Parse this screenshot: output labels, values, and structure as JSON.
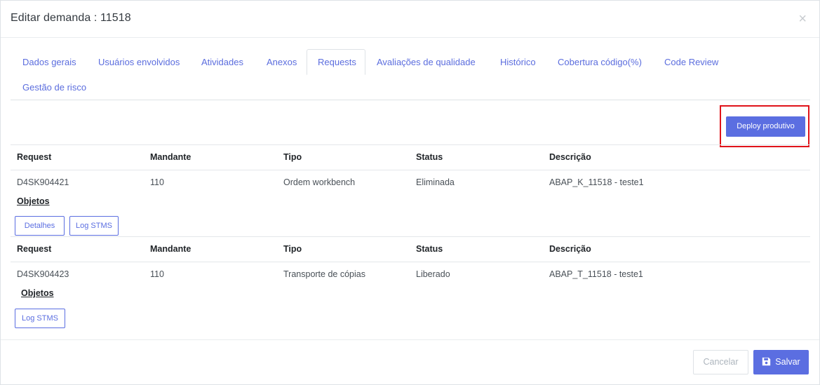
{
  "modal": {
    "title": "Editar demanda : 11518",
    "close_glyph": "×"
  },
  "tabs": [
    {
      "label": "Dados gerais"
    },
    {
      "label": "Usuários envolvidos"
    },
    {
      "label": "Atividades"
    },
    {
      "label": "Anexos"
    },
    {
      "label": "Requests",
      "active": true
    },
    {
      "label": "Avaliações de qualidade"
    },
    {
      "label": "Histórico"
    },
    {
      "label": "Cobertura código(%)"
    },
    {
      "label": "Code Review"
    },
    {
      "label": "Gestão de risco"
    }
  ],
  "toolbar": {
    "deploy_label": "Deploy produtivo"
  },
  "columns": [
    "Request",
    "Mandante",
    "Tipo",
    "Status",
    "Descrição"
  ],
  "requests": [
    {
      "request": "D4SK904421",
      "mandante": "110",
      "tipo": "Ordem workbench",
      "status": "Eliminada",
      "descricao": "ABAP_K_11518 - teste1",
      "objetos_label": "Objetos",
      "detalhes_label": "Detalhes",
      "log_label": "Log STMS"
    },
    {
      "request": "D4SK904423",
      "mandante": "110",
      "tipo": "Transporte de cópias",
      "status": "Liberado",
      "descricao": "ABAP_T_11518 - teste1",
      "objetos_label": "Objetos",
      "log_label": "Log STMS"
    }
  ],
  "footer": {
    "cancel_label": "Cancelar",
    "save_label": "Salvar"
  },
  "colors": {
    "accent": "#5b6ee1",
    "highlight": "#e0131a"
  },
  "icons": [
    "close-icon",
    "floppy-disk-icon"
  ]
}
